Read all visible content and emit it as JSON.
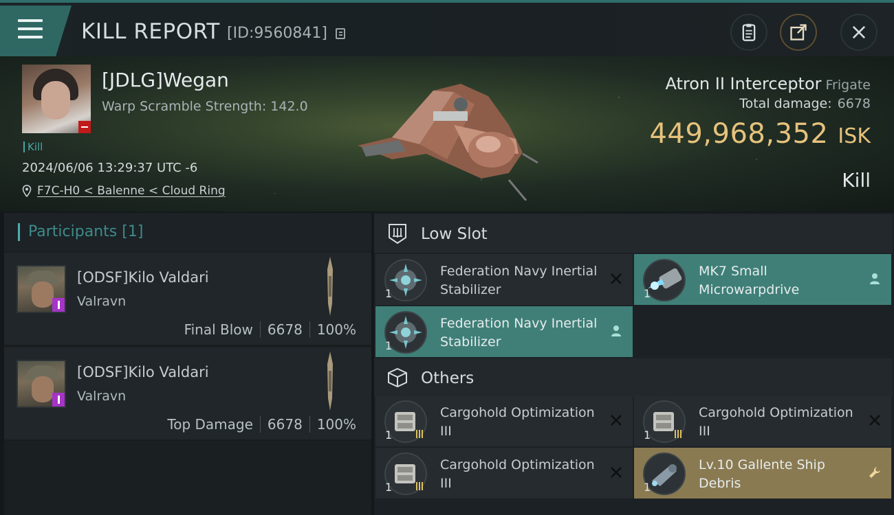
{
  "header": {
    "title": "KILL REPORT",
    "report_id": "[ID:9560841]"
  },
  "victim": {
    "name": "[JDLG]Wegan",
    "scramble": "Warp Scramble Strength: 142.0",
    "tag": "Kill",
    "datetime": "2024/06/06 13:29:37 UTC -6",
    "location": "F7C-H0 < Balenne < Cloud Ring"
  },
  "ship": {
    "name": "Atron II Interceptor",
    "class": "Frigate",
    "damage_label": "Total damage:",
    "damage_value": "6678",
    "isk_value": "449,968,352",
    "isk_unit": "ISK",
    "result": "Kill"
  },
  "participants": {
    "title": "Participants",
    "count": "[1]",
    "rows": [
      {
        "name": "[ODSF]Kilo Valdari",
        "ship": "Valravn",
        "role": "Final Blow",
        "damage": "6678",
        "percent": "100%"
      },
      {
        "name": "[ODSF]Kilo Valdari",
        "ship": "Valravn",
        "role": "Top Damage",
        "damage": "6678",
        "percent": "100%"
      }
    ]
  },
  "sections": {
    "low_slot": {
      "title": "Low Slot",
      "items": [
        {
          "name": "Federation Navy Inertial Stabilizer",
          "qty": "1",
          "state": "destroyed"
        },
        {
          "name": "MK7 Small Microwarpdrive",
          "qty": "1",
          "state": "dropped"
        },
        {
          "name": "Federation Navy Inertial Stabilizer",
          "qty": "1",
          "state": "dropped"
        }
      ]
    },
    "others": {
      "title": "Others",
      "items": [
        {
          "name": "Cargohold Optimization III",
          "qty": "1",
          "state": "destroyed"
        },
        {
          "name": "Cargohold Optimization III",
          "qty": "1",
          "state": "destroyed"
        },
        {
          "name": "Cargohold Optimization III",
          "qty": "1",
          "state": "destroyed"
        },
        {
          "name": "Lv.10 Gallente Ship Debris",
          "qty": "1",
          "state": "salvage"
        }
      ]
    }
  },
  "colors": {
    "accent_teal": "#3f7f78",
    "isk_gold": "#e6c27c",
    "salvage_gold": "#8a7a52",
    "loss_red": "#c11a1a"
  }
}
